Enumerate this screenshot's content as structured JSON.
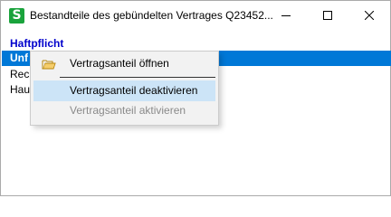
{
  "window": {
    "title": "Bestandteile des gebündelten Vertrages Q23452...",
    "app_icon_letter": "S",
    "app_icon_color": "#1aa33c"
  },
  "list": {
    "section_header": "Haftpflicht",
    "section_header_color": "#0000cc",
    "rows": [
      "Unf",
      "Rech",
      "Haus"
    ],
    "selected_color": "#0078d7"
  },
  "context_menu": {
    "items": [
      {
        "label": "Vertragsanteil öffnen",
        "icon": "folder-open-icon",
        "enabled": true
      },
      {
        "label": "Vertragsanteil deaktivieren",
        "enabled": true,
        "highlighted": true
      },
      {
        "label": "Vertragsanteil aktivieren",
        "enabled": false
      }
    ],
    "highlight_color": "#cce4f7"
  }
}
